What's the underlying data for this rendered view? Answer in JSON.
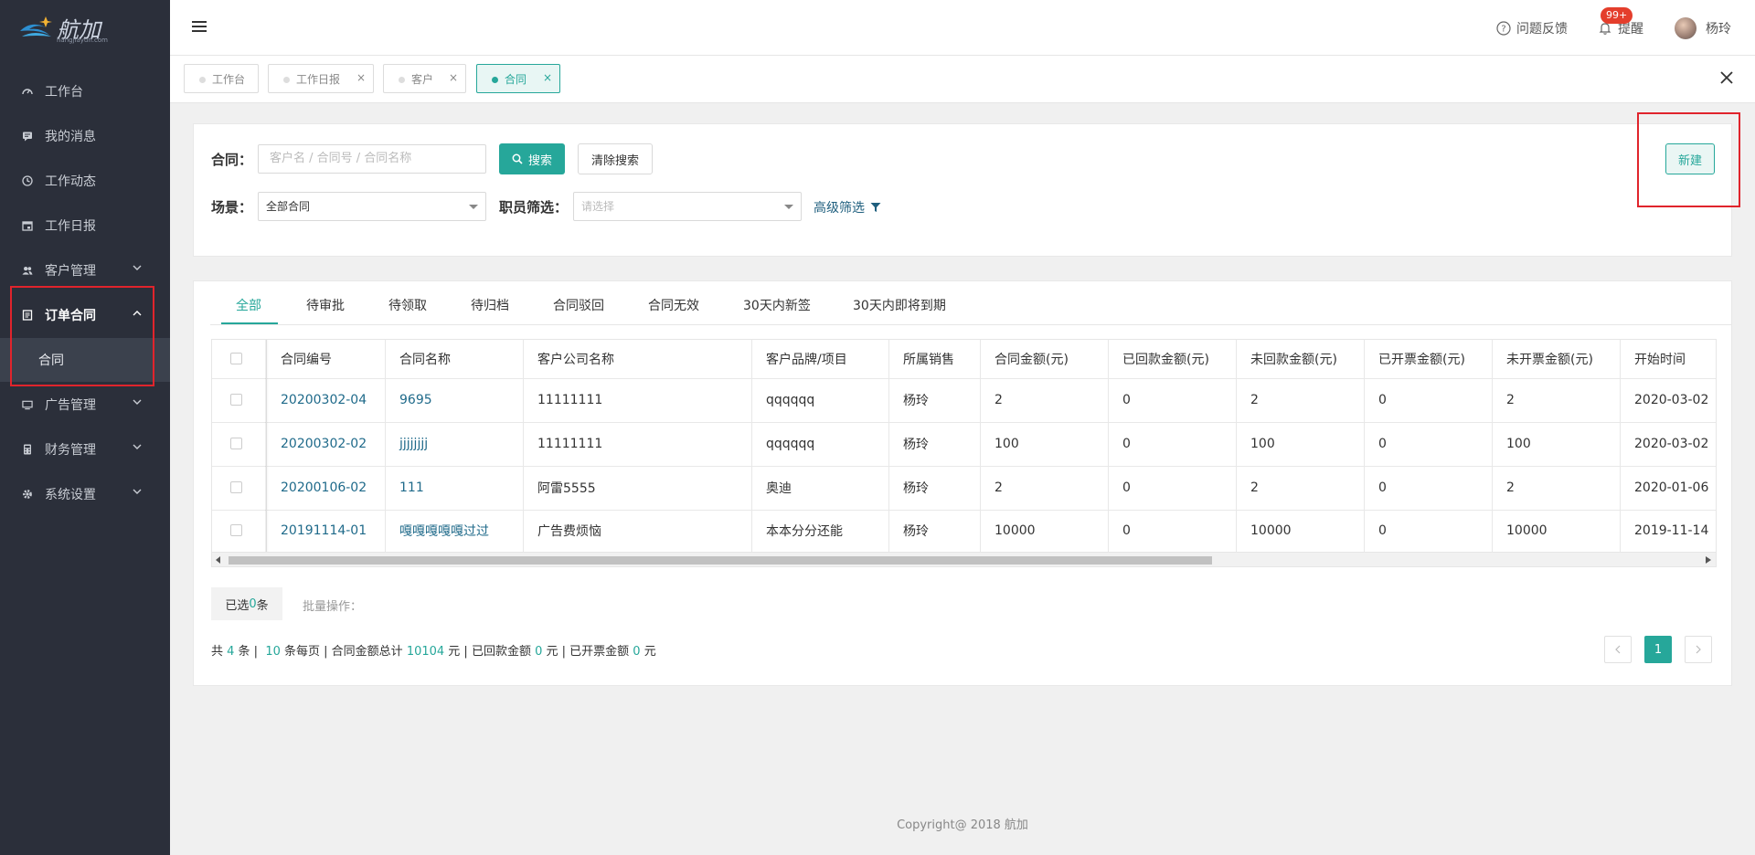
{
  "brand": {
    "name": "航加",
    "domain": "hangjiayun.com"
  },
  "sidebar": {
    "items": [
      {
        "label": "工作台"
      },
      {
        "label": "我的消息"
      },
      {
        "label": "工作动态"
      },
      {
        "label": "工作日报"
      },
      {
        "label": "客户管理"
      },
      {
        "label": "订单合同"
      },
      {
        "label": "合同"
      },
      {
        "label": "广告管理"
      },
      {
        "label": "财务管理"
      },
      {
        "label": "系统设置"
      }
    ]
  },
  "topbar": {
    "feedback": "问题反馈",
    "badge": "99+",
    "remind": "提醒",
    "user": "杨玲"
  },
  "tabs": [
    {
      "label": "工作台"
    },
    {
      "label": "工作日报"
    },
    {
      "label": "客户"
    },
    {
      "label": "合同"
    }
  ],
  "search": {
    "contract_label": "合同：",
    "placeholder": "客户名 / 合同号 / 合同名称",
    "search_btn": "搜索",
    "clear_btn": "清除搜索",
    "new_btn": "新建",
    "scene_label": "场景：",
    "scene_value": "全部合同",
    "staff_label": "职员筛选：",
    "staff_placeholder": "请选择",
    "advanced": "高级筛选"
  },
  "filter_tabs": [
    "全部",
    "待审批",
    "待领取",
    "待归档",
    "合同驳回",
    "合同无效",
    "30天内新签",
    "30天内即将到期"
  ],
  "table": {
    "headers": [
      "合同编号",
      "合同名称",
      "客户公司名称",
      "客户品牌/项目",
      "所属销售",
      "合同金额(元)",
      "已回款金额(元)",
      "未回款金额(元)",
      "已开票金额(元)",
      "未开票金额(元)",
      "开始时间"
    ],
    "rows": [
      [
        "20200302-04",
        "9695",
        "11111111",
        "qqqqqq",
        "杨玲",
        "2",
        "0",
        "2",
        "0",
        "2",
        "2020-03-02"
      ],
      [
        "20200302-02",
        "jjjjjjjj",
        "11111111",
        "qqqqqq",
        "杨玲",
        "100",
        "0",
        "100",
        "0",
        "100",
        "2020-03-02"
      ],
      [
        "20200106-02",
        "111",
        "阿雷5555",
        "奥迪",
        "杨玲",
        "2",
        "0",
        "2",
        "0",
        "2",
        "2020-01-06"
      ],
      [
        "20191114-01",
        "嘎嘎嘎嘎嘎过过",
        "广告费烦恼",
        "本本分分还能",
        "杨玲",
        "10000",
        "0",
        "10000",
        "0",
        "10000",
        "2019-11-14"
      ]
    ]
  },
  "selection": {
    "prefix": "已选 ",
    "count": "0",
    "suffix": " 条",
    "batch": "批量操作："
  },
  "summary": {
    "p1": "共 ",
    "total": "4",
    "p2": " 条 |  ",
    "per_page": "10",
    "p3": " 条每页 | 合同金额总计 ",
    "amount": "10104",
    "p4": " 元 | 已回款金额 ",
    "received": "0",
    "p5": " 元 | 已开票金额 ",
    "invoiced": "0",
    "p6": " 元"
  },
  "pagination": {
    "current": "1"
  },
  "footer": "Copyright@ 2018 航加",
  "colors": {
    "accent": "#26a79a",
    "sidebar": "#2b2f3a",
    "highlight": "#e0242c"
  }
}
